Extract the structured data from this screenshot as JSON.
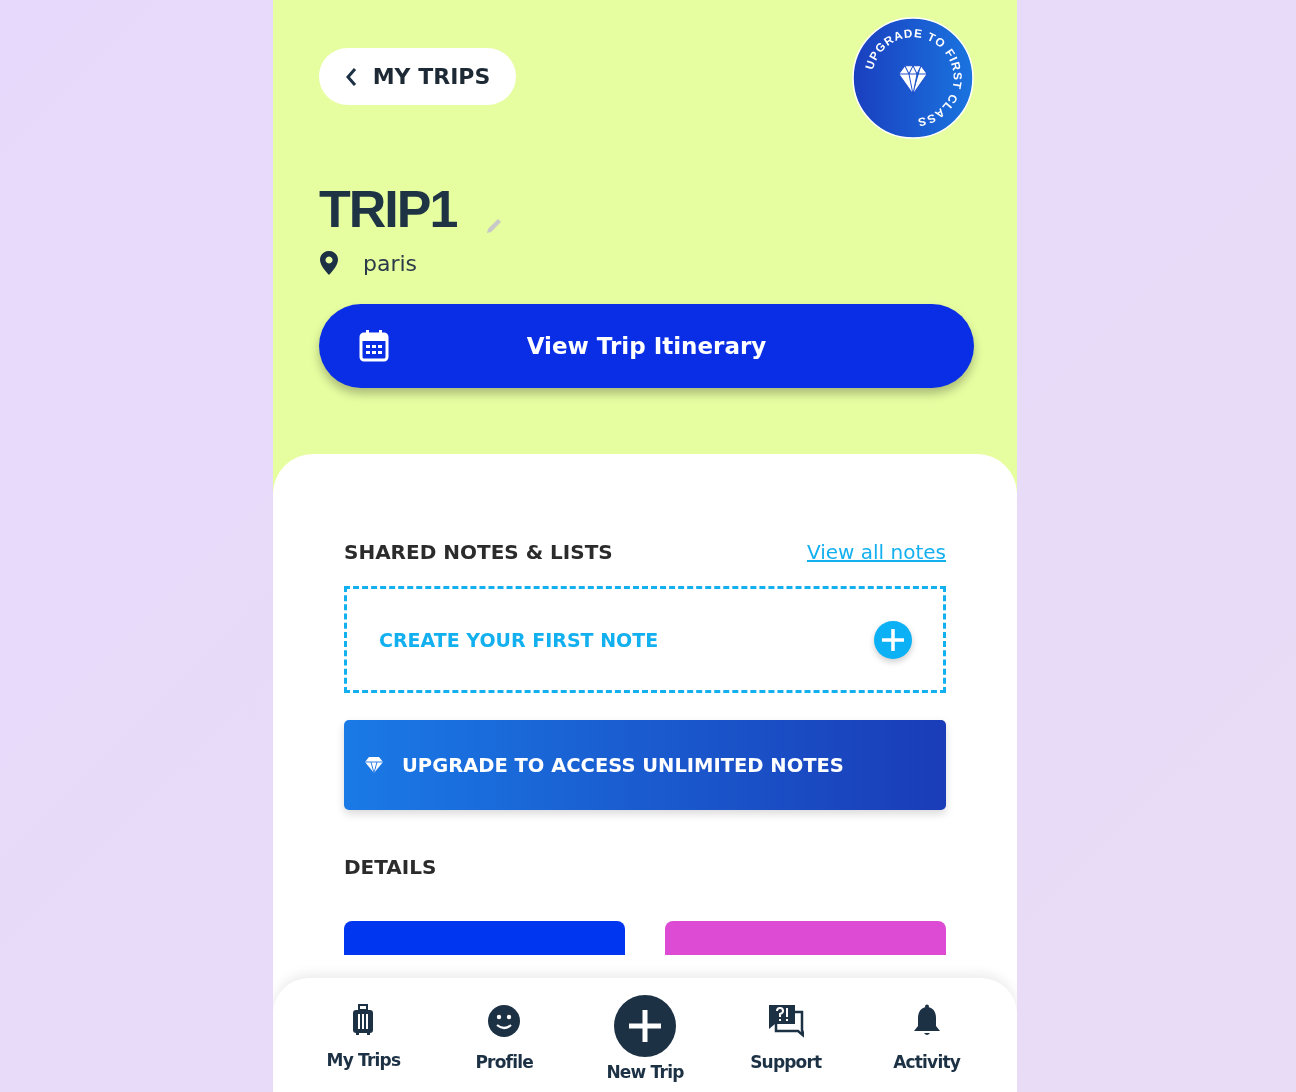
{
  "back_button": {
    "label": "MY TRIPS"
  },
  "badge": {
    "text": "UPGRADE TO FIRST CLASS"
  },
  "trip": {
    "title": "TRIP1",
    "location": "paris"
  },
  "itinerary_button": {
    "label": "View Trip Itinerary"
  },
  "notes": {
    "heading": "SHARED NOTES & LISTS",
    "link": "View all notes",
    "create": "CREATE YOUR FIRST NOTE",
    "upgrade": "UPGRADE TO ACCESS UNLIMITED NOTES"
  },
  "details": {
    "heading": "DETAILS",
    "cards": [
      {
        "color": "#0036f0"
      },
      {
        "color": "#dd4bd4"
      }
    ]
  },
  "nav": [
    {
      "kind": "trips",
      "label": "My Trips"
    },
    {
      "kind": "profile",
      "label": "Profile"
    },
    {
      "kind": "new",
      "label": "New Trip"
    },
    {
      "kind": "support",
      "label": "Support"
    },
    {
      "kind": "activity",
      "label": "Activity"
    }
  ]
}
